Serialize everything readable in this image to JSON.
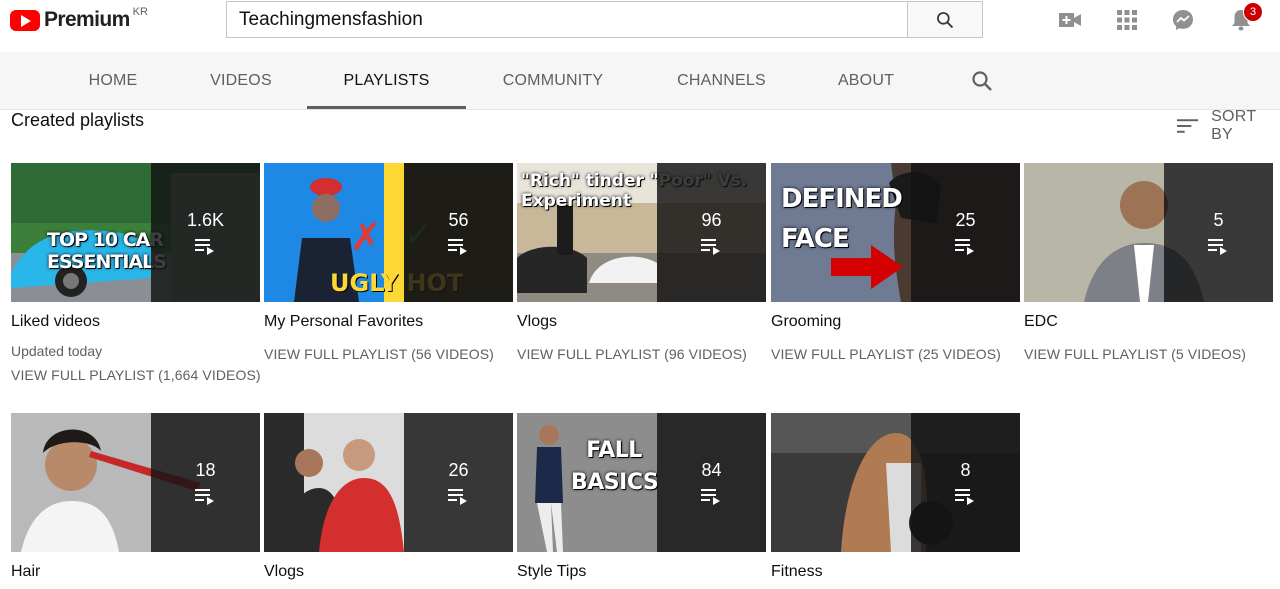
{
  "masthead": {
    "logo_text": "Premium",
    "logo_country": "KR",
    "search_value": "Teachingmensfashion",
    "notification_count": "3"
  },
  "tabs": [
    {
      "label": "HOME"
    },
    {
      "label": "VIDEOS"
    },
    {
      "label": "PLAYLISTS"
    },
    {
      "label": "COMMUNITY"
    },
    {
      "label": "CHANNELS"
    },
    {
      "label": "ABOUT"
    }
  ],
  "section": {
    "title": "Created playlists",
    "sort_label": "SORT BY"
  },
  "playlists": [
    {
      "title": "Liked videos",
      "count": "1.6K",
      "updated": "Updated today",
      "link": "VIEW FULL PLAYLIST (1,664 VIDEOS)",
      "thumb_text": "TOP 10 CAR ESSENTIALS"
    },
    {
      "title": "My Personal Favorites",
      "count": "56",
      "link": "VIEW FULL PLAYLIST (56 VIDEOS)",
      "thumb_text": "UGLY HOT"
    },
    {
      "title": "Vlogs",
      "count": "96",
      "link": "VIEW FULL PLAYLIST (96 VIDEOS)",
      "thumb_text": "\"Rich\" tinder \"Poor\" Vs. Experiment"
    },
    {
      "title": "Grooming",
      "count": "25",
      "link": "VIEW FULL PLAYLIST (25 VIDEOS)",
      "thumb_text": "DEFINED FACE"
    },
    {
      "title": "EDC",
      "count": "5",
      "link": "VIEW FULL PLAYLIST (5 VIDEOS)"
    },
    {
      "title": "Hair",
      "count": "18"
    },
    {
      "title": "Vlogs",
      "count": "26"
    },
    {
      "title": "Style Tips",
      "count": "84",
      "thumb_text": "FALL BASICS"
    },
    {
      "title": "Fitness",
      "count": "8"
    }
  ],
  "colors": {
    "brand_red": "#ff0000",
    "badge_red": "#cc0000",
    "overlay": "#121212",
    "muted_text": "#606060"
  }
}
